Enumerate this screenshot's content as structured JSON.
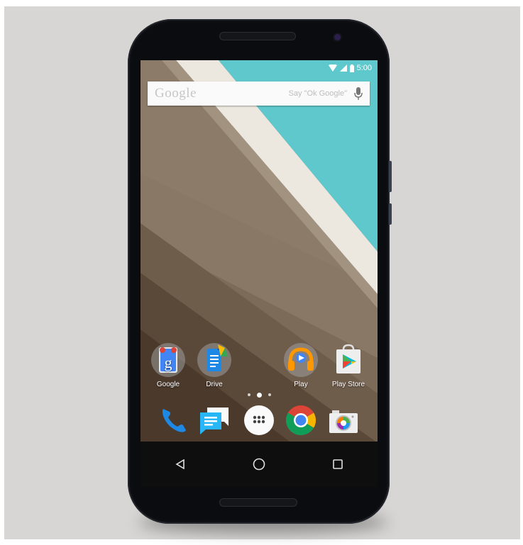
{
  "status_bar": {
    "time": "5:00"
  },
  "search": {
    "logo": "Google",
    "hint": "Say \"Ok Google\""
  },
  "home_apps": [
    {
      "label": "Google",
      "icon": "google-search-icon"
    },
    {
      "label": "Drive",
      "icon": "drive-icon"
    },
    {
      "label": "Play",
      "icon": "play-icon"
    },
    {
      "label": "Play Store",
      "icon": "play-store-icon"
    }
  ],
  "dock": [
    "phone-icon",
    "messenger-icon",
    "app-drawer-icon",
    "chrome-icon",
    "camera-icon"
  ],
  "nav": [
    "back-icon",
    "home-icon",
    "recents-icon"
  ],
  "colors": {
    "wallpaper_teal": "#5ec8cc",
    "wallpaper_cream": "#ece8df",
    "wallpaper_brown": "#7c6a58",
    "wallpaper_dark_brown": "#4b3a2c",
    "phone_body": "#0b0c10",
    "background": "#d7d6d4"
  }
}
